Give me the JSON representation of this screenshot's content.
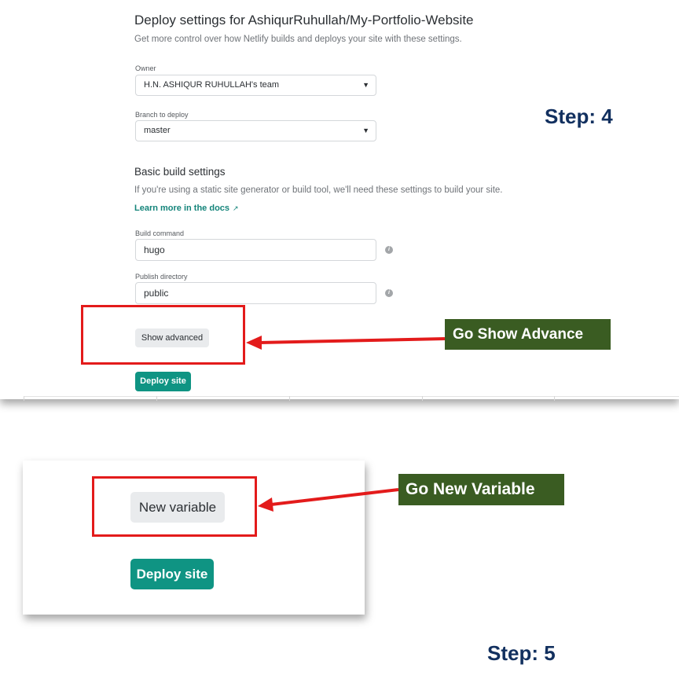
{
  "step4": {
    "label": "Step: 4",
    "deploy_settings": {
      "title": "Deploy settings for AshiqurRuhullah/My-Portfolio-Website",
      "subtitle": "Get more control over how Netlify builds and deploys your site with these settings.",
      "owner": {
        "label": "Owner",
        "value": "H.N. ASHIQUR RUHULLAH's team",
        "icon": "chevron-down-icon"
      },
      "branch": {
        "label": "Branch to deploy",
        "value": "master",
        "icon": "chevron-down-icon"
      },
      "basic_build": {
        "title": "Basic build settings",
        "description": "If you're using a static site generator or build tool, we'll need these settings to build your site.",
        "docs_link": "Learn more in the docs",
        "docs_link_icon": "external-link-arrow-icon",
        "build_command": {
          "label": "Build command",
          "value": "hugo",
          "icon": "info-icon"
        },
        "publish_directory": {
          "label": "Publish directory",
          "value": "public",
          "icon": "info-icon"
        }
      },
      "show_advanced_button": "Show advanced",
      "deploy_button": "Deploy site"
    },
    "callout": "Go Show Advance"
  },
  "step5": {
    "label": "Step: 5",
    "new_variable_button": "New variable",
    "deploy_button": "Deploy site",
    "callout": "Go New Variable"
  },
  "colors": {
    "highlight_red": "#e31b1b",
    "callout_green": "#3a5c22",
    "step_navy": "#12305f",
    "netlify_teal": "#0f9483"
  }
}
